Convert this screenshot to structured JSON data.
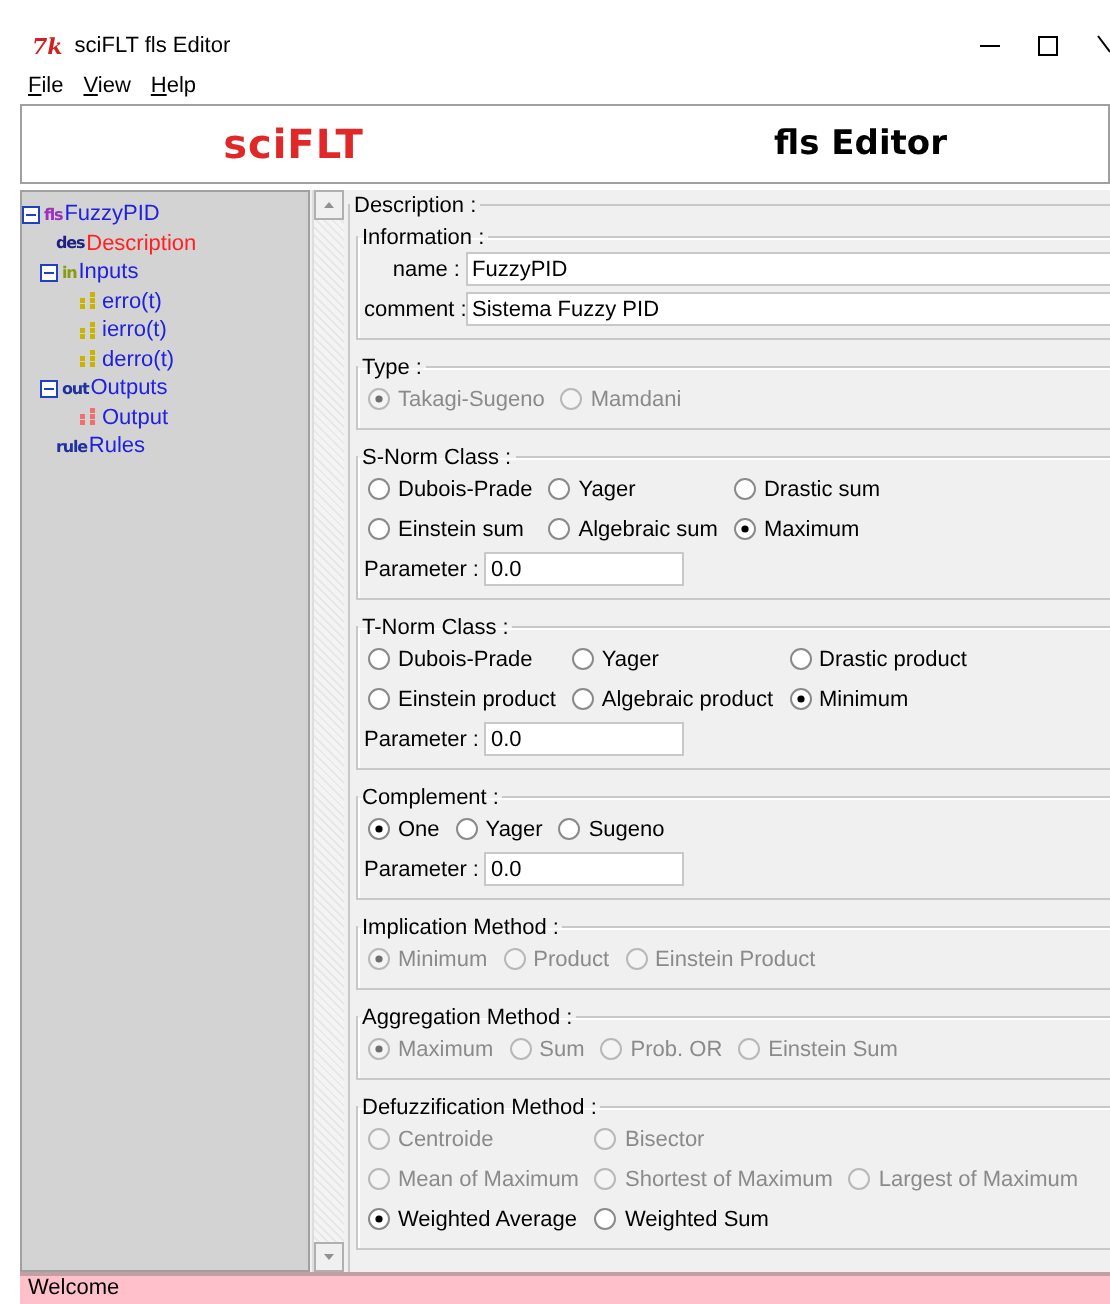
{
  "window": {
    "app_icon": "7k",
    "title": "sciFLT fls Editor"
  },
  "menu": [
    {
      "label": "File"
    },
    {
      "label": "View"
    },
    {
      "label": "Help"
    }
  ],
  "banner": {
    "logo": "sciFLT",
    "title": "fls Editor"
  },
  "tree": [
    {
      "label": "FuzzyPID",
      "kind": "badge",
      "badge": "fls",
      "color": "#9b30c0",
      "expanded": true,
      "selected": false,
      "children": [
        {
          "label": "Description",
          "kind": "badge",
          "badge": "des",
          "color": "#202080",
          "selected": true
        },
        {
          "label": "Inputs",
          "kind": "badge",
          "badge": "in",
          "color": "#8a9a10",
          "expanded": true,
          "selected": false,
          "children": [
            {
              "label": "erro(t)",
              "kind": "dots",
              "color": "#c8b400",
              "selected": false
            },
            {
              "label": "ierro(t)",
              "kind": "dots",
              "color": "#c8b400",
              "selected": false
            },
            {
              "label": "derro(t)",
              "kind": "dots",
              "color": "#c8b400",
              "selected": false
            }
          ]
        },
        {
          "label": "Outputs",
          "kind": "badge",
          "badge": "out",
          "color": "#2030a0",
          "expanded": true,
          "selected": false,
          "children": [
            {
              "label": "Output",
              "kind": "dots",
              "color": "#f07070",
              "selected": false
            }
          ]
        },
        {
          "label": "Rules",
          "kind": "badge",
          "badge": "rule",
          "color": "#2030a0",
          "selected": false
        }
      ]
    }
  ],
  "description": {
    "title": "Description :",
    "information": {
      "title": "Information :",
      "fields": [
        {
          "label": "name :",
          "value": "FuzzyPID"
        },
        {
          "label": "comment :",
          "value": "Sistema Fuzzy PID"
        }
      ]
    },
    "groups": [
      {
        "title": "Type :",
        "rows": [
          [
            {
              "label": "Takagi-Sugeno",
              "selected": true,
              "disabled": true
            },
            {
              "label": "Mamdani",
              "selected": false,
              "disabled": true
            }
          ]
        ]
      },
      {
        "title": "S-Norm Class :",
        "rows": [
          [
            {
              "label": "Dubois-Prade",
              "selected": false,
              "disabled": false
            },
            {
              "label": "Yager",
              "selected": false,
              "disabled": false
            },
            {
              "label": "Drastic sum",
              "selected": false,
              "disabled": false
            }
          ],
          [
            {
              "label": "Einstein sum",
              "selected": false,
              "disabled": false
            },
            {
              "label": "Algebraic sum",
              "selected": false,
              "disabled": false
            },
            {
              "label": "Maximum",
              "selected": true,
              "disabled": false
            }
          ]
        ],
        "parameter": {
          "label": "Parameter :",
          "value": "0.0"
        }
      },
      {
        "title": "T-Norm Class :",
        "rows": [
          [
            {
              "label": "Dubois-Prade",
              "selected": false,
              "disabled": false
            },
            {
              "label": "Yager",
              "selected": false,
              "disabled": false
            },
            {
              "label": "Drastic product",
              "selected": false,
              "disabled": false
            }
          ],
          [
            {
              "label": "Einstein product",
              "selected": false,
              "disabled": false
            },
            {
              "label": "Algebraic product",
              "selected": false,
              "disabled": false
            },
            {
              "label": "Minimum",
              "selected": true,
              "disabled": false
            }
          ]
        ],
        "parameter": {
          "label": "Parameter :",
          "value": "0.0"
        }
      },
      {
        "title": "Complement :",
        "rows": [
          [
            {
              "label": "One",
              "selected": true,
              "disabled": false
            },
            {
              "label": "Yager",
              "selected": false,
              "disabled": false
            },
            {
              "label": "Sugeno",
              "selected": false,
              "disabled": false
            }
          ]
        ],
        "parameter": {
          "label": "Parameter :",
          "value": "0.0"
        }
      },
      {
        "title": "Implication Method :",
        "rows": [
          [
            {
              "label": "Minimum",
              "selected": true,
              "disabled": true
            },
            {
              "label": "Product",
              "selected": false,
              "disabled": true
            },
            {
              "label": "Einstein Product",
              "selected": false,
              "disabled": true
            }
          ]
        ]
      },
      {
        "title": "Aggregation Method :",
        "rows": [
          [
            {
              "label": "Maximum",
              "selected": true,
              "disabled": true
            },
            {
              "label": "Sum",
              "selected": false,
              "disabled": true
            },
            {
              "label": "Prob. OR",
              "selected": false,
              "disabled": true
            },
            {
              "label": "Einstein Sum",
              "selected": false,
              "disabled": true
            }
          ]
        ]
      },
      {
        "title": "Defuzzification Method :",
        "rows": [
          [
            {
              "label": "Centroide",
              "selected": false,
              "disabled": true
            },
            {
              "label": "Bisector",
              "selected": false,
              "disabled": true
            }
          ],
          [
            {
              "label": "Mean of Maximum",
              "selected": false,
              "disabled": true
            },
            {
              "label": "Shortest of Maximum",
              "selected": false,
              "disabled": true
            },
            {
              "label": "Largest of Maximum",
              "selected": false,
              "disabled": true
            }
          ],
          [
            {
              "label": "Weighted Average",
              "selected": true,
              "disabled": false
            },
            {
              "label": "Weighted Sum",
              "selected": false,
              "disabled": false
            }
          ]
        ]
      }
    ]
  },
  "status_bar": "Welcome"
}
